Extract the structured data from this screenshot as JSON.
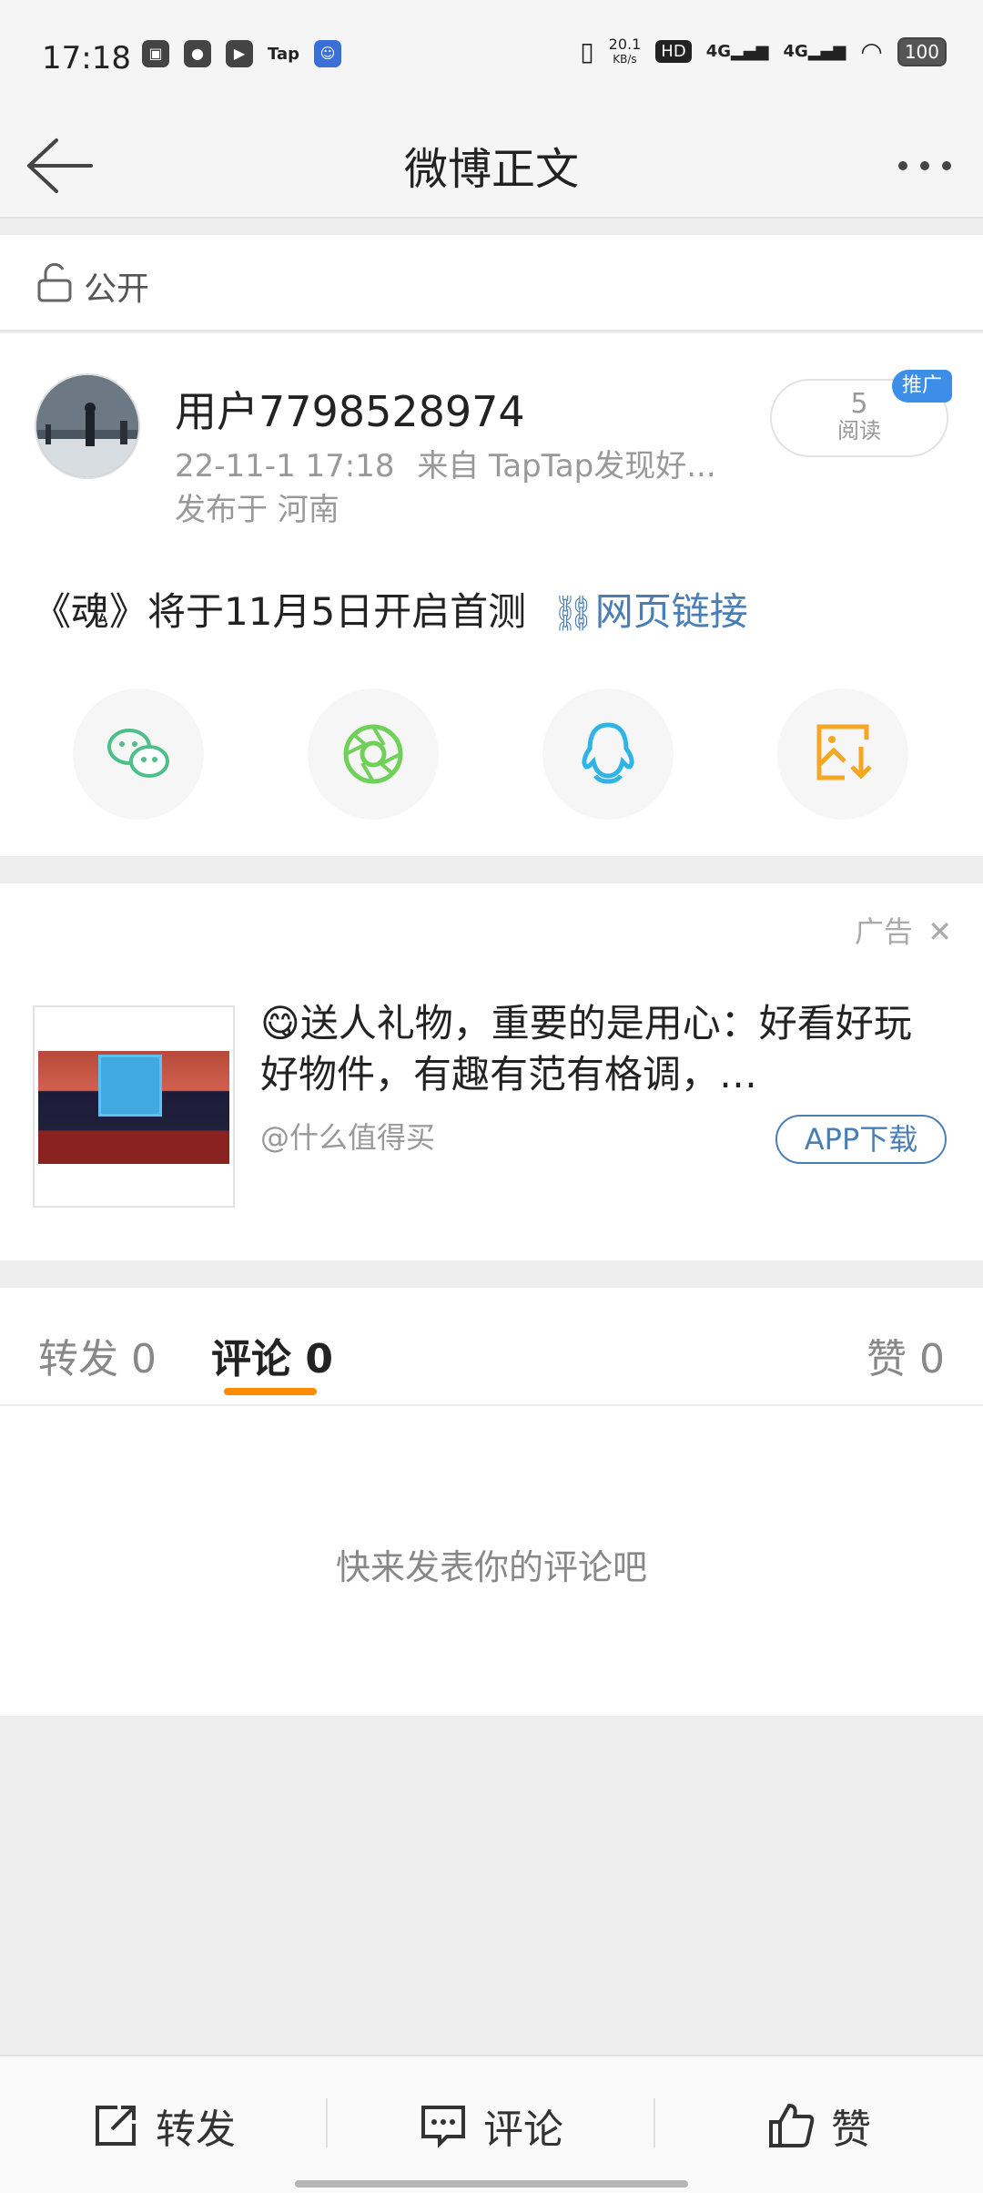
{
  "status_bar": {
    "time": "17:18",
    "app_icons": [
      "calendar-icon",
      "wechat-icon",
      "video-icon",
      "Tap",
      "app-icon"
    ],
    "net_speed_value": "20.1",
    "net_speed_unit": "KB/s",
    "hd_badge": "HD",
    "signal1": "4G",
    "signal2": "4G",
    "battery": "100"
  },
  "navbar": {
    "title": "微博正文"
  },
  "privacy": {
    "label": "公开"
  },
  "post": {
    "username": "用户7798528974",
    "meta_time": "22-11-1 17:18",
    "meta_source": "来自 TapTap发现好...",
    "location": "发布于 河南",
    "read_count": "5",
    "read_label": "阅读",
    "promo_tag": "推广",
    "text": "《魂》将于11月5日开启首测",
    "link_label": "网页链接",
    "share_icons": [
      "wechat-icon",
      "moments-icon",
      "qq-icon",
      "save-image-icon"
    ]
  },
  "ad": {
    "label": "广告",
    "emoji": "😋",
    "title": "送人礼物，重要的是用心：好看好玩好物件，有趣有范有格调，…",
    "source": "@什么值得买",
    "button": "APP下载"
  },
  "tabs": {
    "repost": "转发 0",
    "comment": "评论 0",
    "like": "赞 0"
  },
  "comments": {
    "empty_text": "快来发表你的评论吧"
  },
  "bottom_bar": {
    "repost": "转发",
    "comment": "评论",
    "like": "赞"
  },
  "colors": {
    "accent": "#ff8c00",
    "link": "#4a7fb5",
    "promo": "#3c8ee6"
  }
}
